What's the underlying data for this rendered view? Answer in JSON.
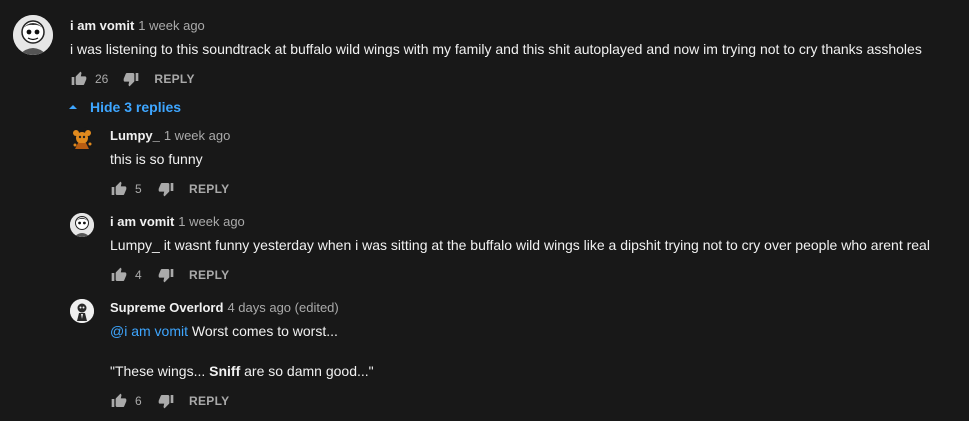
{
  "comments": [
    {
      "author": "i am vomit",
      "time": "1 week ago",
      "text": "i was listening to this soundtrack at buffalo wild wings with my family and this shit autoplayed and now im trying not to cry thanks assholes",
      "likes": "26",
      "reply_label": "REPLY"
    }
  ],
  "replies_toggle": {
    "label": "Hide 3 replies",
    "icon": "caret-up-icon"
  },
  "replies": [
    {
      "author": "Lumpy_",
      "time": "1 week ago",
      "text": "this is so funny",
      "likes": "5",
      "reply_label": "REPLY"
    },
    {
      "author": "i am vomit",
      "time": "1 week ago",
      "text": "Lumpy_ it wasnt funny yesterday when i was sitting at the buffalo wild wings like a dipshit trying not to cry over people who arent real",
      "likes": "4",
      "reply_label": "REPLY"
    },
    {
      "author": "Supreme Overlord",
      "time": "4 days ago (edited)",
      "mention": "@i am vomit",
      "text_line1": " Worst comes to worst...",
      "text_line2_a": "\"These wings... ",
      "text_line2_bold": "Sniff",
      "text_line2_b": " are so damn good...\"",
      "likes": "6",
      "reply_label": "REPLY"
    }
  ],
  "colors": {
    "background": "#181818",
    "text": "#f1f1f1",
    "secondary": "#aaaaaa",
    "link": "#3ea6ff"
  },
  "icons": {
    "like": "thumbs-up-icon",
    "dislike": "thumbs-down-icon"
  }
}
